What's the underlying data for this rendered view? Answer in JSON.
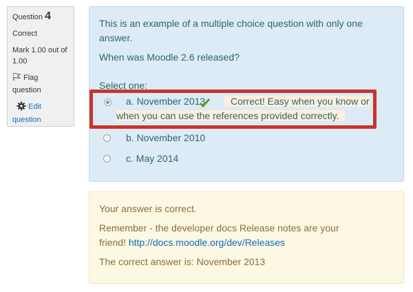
{
  "info": {
    "question_label": "Question",
    "question_number": "4",
    "state": "Correct",
    "mark_line1": "Mark 1.00 out of",
    "mark_line2": "1.00",
    "flag_label_1": "Flag",
    "flag_label_2": "question",
    "edit_label_1": "Edit",
    "edit_label_2": "question"
  },
  "question": {
    "intro_line1": "This is an example of a multiple choice question with only one",
    "intro_line2": "answer.",
    "text": "When was Moodle 2.6 released?",
    "prompt": "Select one:",
    "options": [
      {
        "label": "a. November 2013",
        "checked": true,
        "feedback_line1": "Correct! Easy when you know or",
        "feedback_line2": "when you can use the references provided correctly."
      },
      {
        "label": "b. November 2010",
        "checked": false
      },
      {
        "label": "c. May 2014",
        "checked": false
      }
    ]
  },
  "outcome": {
    "state_text": "Your answer is correct.",
    "general_feedback_line1": "Remember - the developer docs Release notes are your",
    "general_feedback_prefix": "friend!",
    "link_text": "http://docs.moodle.org/dev/Releases",
    "right_answer": "The correct answer is: November 2013"
  },
  "colors": {
    "highlight_border": "#c8352a",
    "formulation_bg": "#dcebf5",
    "outcome_bg": "#fcf8e3",
    "tick": "#5fa018"
  }
}
